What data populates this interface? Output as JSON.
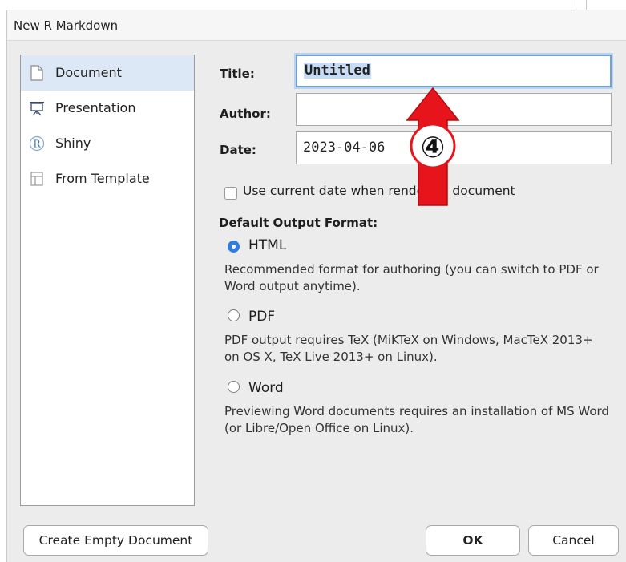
{
  "dialog": {
    "title": "New R Markdown"
  },
  "sidebar": {
    "items": [
      {
        "label": "Document",
        "icon": "document-icon",
        "selected": true
      },
      {
        "label": "Presentation",
        "icon": "presentation-icon",
        "selected": false
      },
      {
        "label": "Shiny",
        "icon": "shiny-icon",
        "selected": false
      },
      {
        "label": "From Template",
        "icon": "template-icon",
        "selected": false
      }
    ],
    "shiny_icon_glyph": "R"
  },
  "form": {
    "title_label": "Title:",
    "title_value": "Untitled",
    "author_label": "Author:",
    "author_value": "",
    "date_label": "Date:",
    "date_value": "2023-04-06",
    "use_current_date_label": "Use current date when rendering document",
    "use_current_date_checked": false
  },
  "output_format": {
    "heading": "Default Output Format:",
    "options": [
      {
        "label": "HTML",
        "selected": true,
        "description": "Recommended format for authoring (you can switch to PDF or Word output anytime)."
      },
      {
        "label": "PDF",
        "selected": false,
        "description": "PDF output requires TeX (MiKTeX on Windows, MacTeX 2013+ on OS X, TeX Live 2013+ on Linux)."
      },
      {
        "label": "Word",
        "selected": false,
        "description": "Previewing Word documents requires an installation of MS Word (or Libre/Open Office on Linux)."
      }
    ]
  },
  "buttons": {
    "create_empty": "Create Empty Document",
    "ok": "OK",
    "cancel": "Cancel"
  },
  "annotation": {
    "marker": "④",
    "color": "#e8141c"
  }
}
